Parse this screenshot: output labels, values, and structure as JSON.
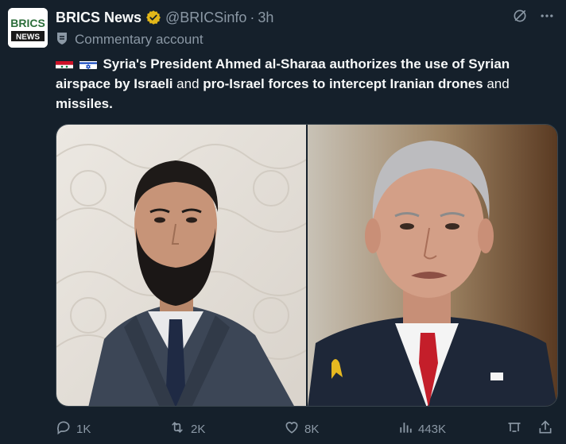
{
  "author": {
    "avatar_text_top": "BRICS",
    "avatar_text_bottom": "NEWS",
    "name": "BRICS News",
    "handle": "@BRICSinfo",
    "separator": "·",
    "time": "3h"
  },
  "label": {
    "text": "Commentary account"
  },
  "tweet": {
    "part1": "Syria's President Ahmed al-Sharaa authorizes the use of Syrian airspace by Israeli",
    "part2": " and ",
    "part3": "pro-Israel forces to intercept Iranian drones",
    "part4": " and ",
    "part5": "missiles."
  },
  "actions": {
    "replies": "1K",
    "reposts": "2K",
    "likes": "8K",
    "views": "443K"
  },
  "colors": {
    "background": "#15202b",
    "text": "#f7f9f9",
    "muted": "#8b98a5",
    "verified": "#e2b719"
  }
}
